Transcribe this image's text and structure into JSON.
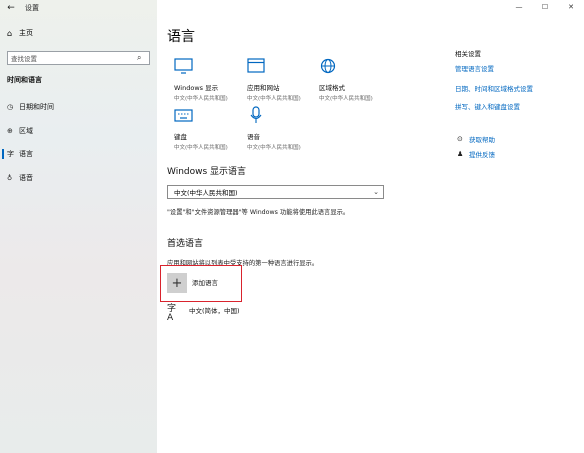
{
  "window": {
    "title": "设置",
    "back_glyph": "←",
    "minimize": "—",
    "maximize": "☐",
    "close": "✕"
  },
  "sidebar": {
    "home": "主页",
    "search_placeholder": "查找设置",
    "section": "时间和语言",
    "items": [
      {
        "label": "日期和时间",
        "icon": "clock-icon"
      },
      {
        "label": "区域",
        "icon": "globe-icon"
      },
      {
        "label": "语言",
        "icon": "language-icon",
        "active": true
      },
      {
        "label": "语音",
        "icon": "microphone-icon"
      }
    ]
  },
  "main": {
    "title": "语言",
    "tiles": [
      {
        "name": "Windows 显示",
        "sub": "中文(中华人民共和国)",
        "icon": "monitor-icon"
      },
      {
        "name": "应用和网站",
        "sub": "中文(中华人民共和国)",
        "icon": "window-icon"
      },
      {
        "name": "区域格式",
        "sub": "中文(中华人民共和国)",
        "icon": "globe-icon"
      },
      {
        "name": "键盘",
        "sub": "中文(中华人民共和国)",
        "icon": "keyboard-icon"
      },
      {
        "name": "语音",
        "sub": "中文(中华人民共和国)",
        "icon": "microphone-icon"
      }
    ],
    "display_heading": "Windows 显示语言",
    "display_value": "中文(中华人民共和国)",
    "display_note": "\"设置\"和\"文件资源管理器\"等 Windows 功能将使用此语言显示。",
    "preferred_heading": "首选语言",
    "preferred_desc": "应用和网站将以列表中受支持的第一种语言进行显示。",
    "add_label": "添加语言",
    "languages": [
      {
        "name": "中文(简体，中国)"
      }
    ]
  },
  "related": {
    "heading": "相关设置",
    "links": [
      "管理语言设置",
      "日期、时间和区域格式设置",
      "拼写、键入和键盘设置"
    ],
    "help": "获取帮助",
    "feedback": "提供反馈"
  },
  "colors": {
    "accent": "#0067c0",
    "highlight_box": "#d9232d"
  }
}
